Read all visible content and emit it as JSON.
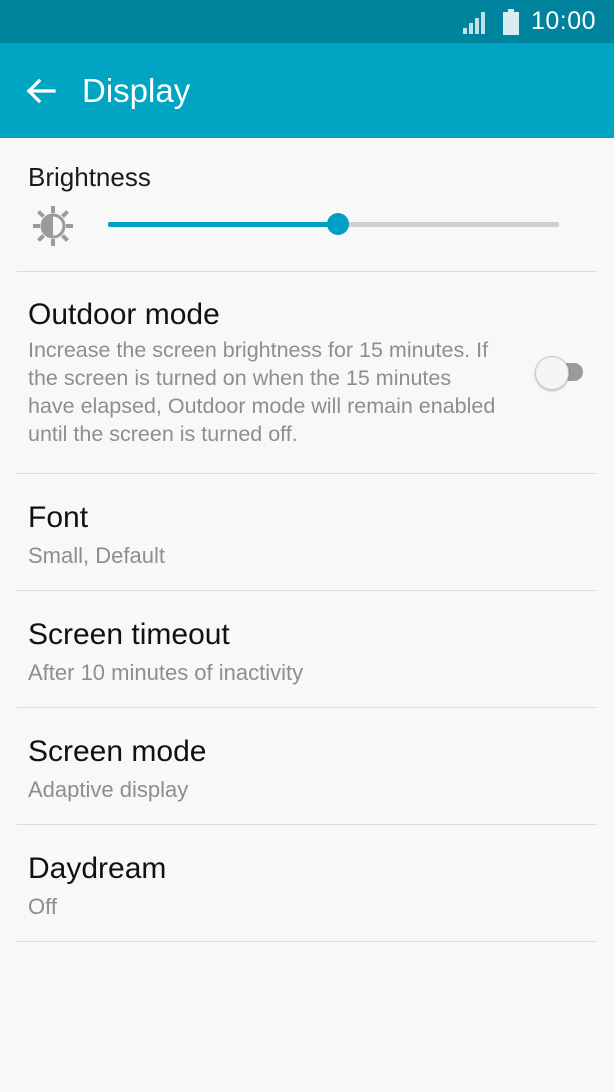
{
  "status_bar": {
    "time": "10:00"
  },
  "app_bar": {
    "title": "Display"
  },
  "brightness": {
    "label": "Brightness",
    "level": 0.51
  },
  "outdoor_mode": {
    "title": "Outdoor mode",
    "description": "Increase the screen brightness for 15 minutes. If the screen is turned on when the 15 minutes have elapsed, Outdoor mode will remain enabled until the screen is turned off.",
    "enabled": false
  },
  "font": {
    "title": "Font",
    "value": "Small, Default"
  },
  "screen_timeout": {
    "title": "Screen timeout",
    "value": "After 10 minutes of inactivity"
  },
  "screen_mode": {
    "title": "Screen mode",
    "value": "Adaptive display"
  },
  "daydream": {
    "title": "Daydream",
    "value": "Off"
  },
  "colors": {
    "status_bar": "#00849e",
    "app_bar": "#00a5c4",
    "accent": "#00a0c6"
  }
}
